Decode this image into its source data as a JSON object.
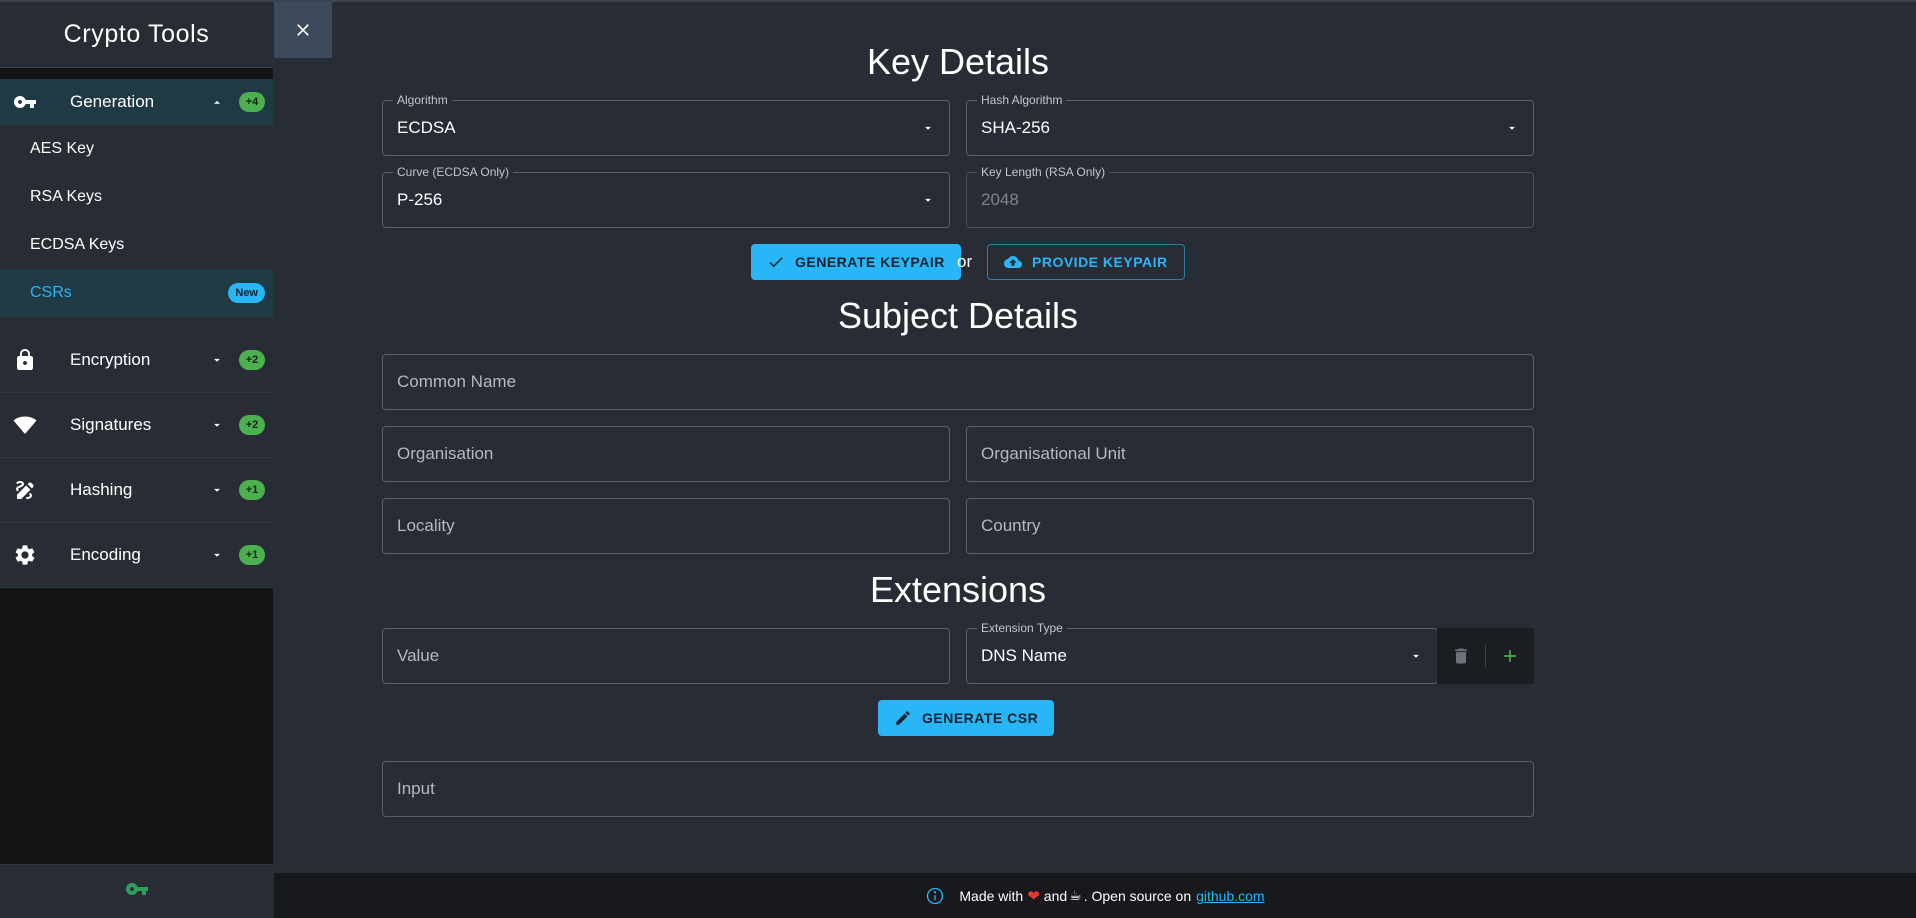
{
  "app": {
    "title": "Crypto Tools"
  },
  "sidebar": {
    "groups": [
      {
        "label": "Generation",
        "badge": "+4",
        "icon": "key-icon",
        "expanded": true,
        "items": [
          {
            "label": "AES Key"
          },
          {
            "label": "RSA Keys"
          },
          {
            "label": "ECDSA Keys"
          },
          {
            "label": "CSRs",
            "badge": "New",
            "selected": true
          }
        ]
      },
      {
        "label": "Encryption",
        "badge": "+2",
        "icon": "lock-icon"
      },
      {
        "label": "Signatures",
        "badge": "+2",
        "icon": "wifi-icon"
      },
      {
        "label": "Hashing",
        "badge": "+1",
        "icon": "draw-icon"
      },
      {
        "label": "Encoding",
        "badge": "+1",
        "icon": "gear-icon"
      }
    ],
    "footer_icon": "key-icon"
  },
  "key_details": {
    "title": "Key Details",
    "algorithm": {
      "label": "Algorithm",
      "value": "ECDSA"
    },
    "hash_algorithm": {
      "label": "Hash Algorithm",
      "value": "SHA-256"
    },
    "curve": {
      "label": "Curve (ECDSA Only)",
      "value": "P-256"
    },
    "key_length": {
      "label": "Key Length (RSA Only)",
      "value": "2048"
    },
    "generate_label": "GENERATE KEYPAIR",
    "or_text": "or",
    "provide_label": "PROVIDE KEYPAIR"
  },
  "subject_details": {
    "title": "Subject Details",
    "common_name": "Common Name",
    "organisation": "Organisation",
    "organisational_unit": "Organisational Unit",
    "locality": "Locality",
    "country": "Country"
  },
  "extensions": {
    "title": "Extensions",
    "value_placeholder": "Value",
    "type_label": "Extension Type",
    "type_value": "DNS Name",
    "generate_csr_label": "GENERATE CSR",
    "input_placeholder": "Input"
  },
  "footer": {
    "made_with": "Made with",
    "and": "and",
    "open_source": ". Open source on",
    "link": "github.com"
  },
  "colors": {
    "accent": "#29b6f6",
    "badge_green": "#4caf50",
    "background": "#282c34",
    "sidebar_selected": "#1f3a45"
  }
}
